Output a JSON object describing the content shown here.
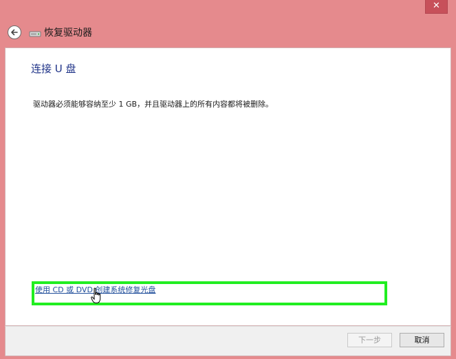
{
  "window": {
    "title": "恢复驱动器",
    "close_label": "✕",
    "frame_color": "#e58a8d"
  },
  "content": {
    "heading": "连接 U 盘",
    "description": "驱动器必须能够容纳至少 1 GB，并且驱动器上的所有内容都将被删除。",
    "cd_link": "使用 CD 或 DVD 创建系统修复光盘",
    "highlight_color": "#21ee21"
  },
  "buttons": {
    "next": "下一步",
    "cancel": "取消"
  },
  "icons": {
    "back": "back-arrow-icon",
    "drive": "drive-icon",
    "cursor": "hand-pointer-icon",
    "close": "close-icon"
  }
}
